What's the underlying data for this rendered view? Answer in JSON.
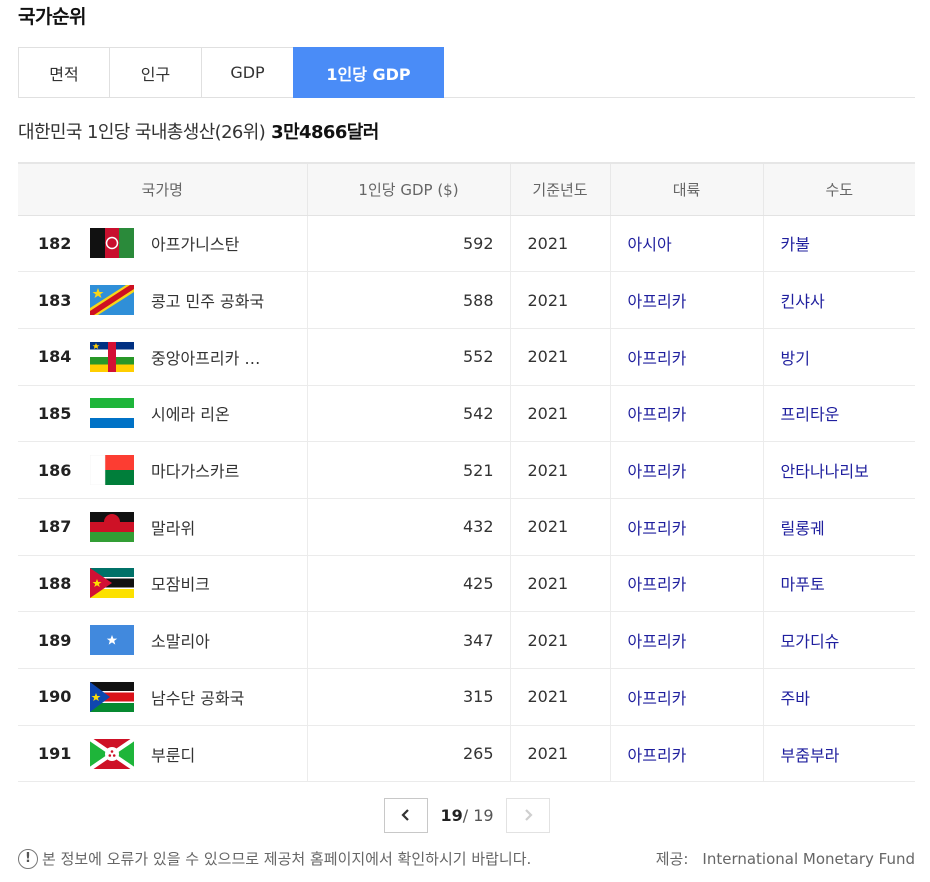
{
  "page_title": "국가순위",
  "tabs": [
    {
      "label": "면적",
      "active": false
    },
    {
      "label": "인구",
      "active": false
    },
    {
      "label": "GDP",
      "active": false
    },
    {
      "label": "1인당 GDP",
      "active": true
    }
  ],
  "summary": {
    "text": "대한민국 1인당 국내총생산(26위)",
    "value": "3만4866달러"
  },
  "table": {
    "headers": [
      "국가명",
      "1인당 GDP ($)",
      "기준년도",
      "대륙",
      "수도"
    ],
    "rows": [
      {
        "rank": "182",
        "flag": "afghanistan-flag",
        "country": "아프가니스탄",
        "gdp": "592",
        "year": "2021",
        "continent": "아시아",
        "capital": "카불"
      },
      {
        "rank": "183",
        "flag": "dr-congo-flag",
        "country": "콩고 민주 공화국",
        "gdp": "588",
        "year": "2021",
        "continent": "아프리카",
        "capital": "킨샤사"
      },
      {
        "rank": "184",
        "flag": "central-african-republic-flag",
        "country": "중앙아프리카 …",
        "gdp": "552",
        "year": "2021",
        "continent": "아프리카",
        "capital": "방기"
      },
      {
        "rank": "185",
        "flag": "sierra-leone-flag",
        "country": "시에라 리온",
        "gdp": "542",
        "year": "2021",
        "continent": "아프리카",
        "capital": "프리타운"
      },
      {
        "rank": "186",
        "flag": "madagascar-flag",
        "country": "마다가스카르",
        "gdp": "521",
        "year": "2021",
        "continent": "아프리카",
        "capital": "안타나나리보"
      },
      {
        "rank": "187",
        "flag": "malawi-flag",
        "country": "말라위",
        "gdp": "432",
        "year": "2021",
        "continent": "아프리카",
        "capital": "릴롱궤"
      },
      {
        "rank": "188",
        "flag": "mozambique-flag",
        "country": "모잠비크",
        "gdp": "425",
        "year": "2021",
        "continent": "아프리카",
        "capital": "마푸토"
      },
      {
        "rank": "189",
        "flag": "somalia-flag",
        "country": "소말리아",
        "gdp": "347",
        "year": "2021",
        "continent": "아프리카",
        "capital": "모가디슈"
      },
      {
        "rank": "190",
        "flag": "south-sudan-flag",
        "country": "남수단 공화국",
        "gdp": "315",
        "year": "2021",
        "continent": "아프리카",
        "capital": "주바"
      },
      {
        "rank": "191",
        "flag": "burundi-flag",
        "country": "부룬디",
        "gdp": "265",
        "year": "2021",
        "continent": "아프리카",
        "capital": "부줌부라"
      }
    ]
  },
  "pagination": {
    "current": "19",
    "separator": "/",
    "total": "19",
    "prev_icon": "chevron-left-icon",
    "next_icon": "chevron-right-icon"
  },
  "footer": {
    "notice": "본 정보에 오류가 있을 수 있으므로 제공처 홈페이지에서 확인하시기 바랍니다.",
    "source_label": "제공:",
    "source_value": "International Monetary Fund"
  },
  "colors": {
    "accent": "#4a8cf7",
    "link": "#1f1f9e"
  }
}
